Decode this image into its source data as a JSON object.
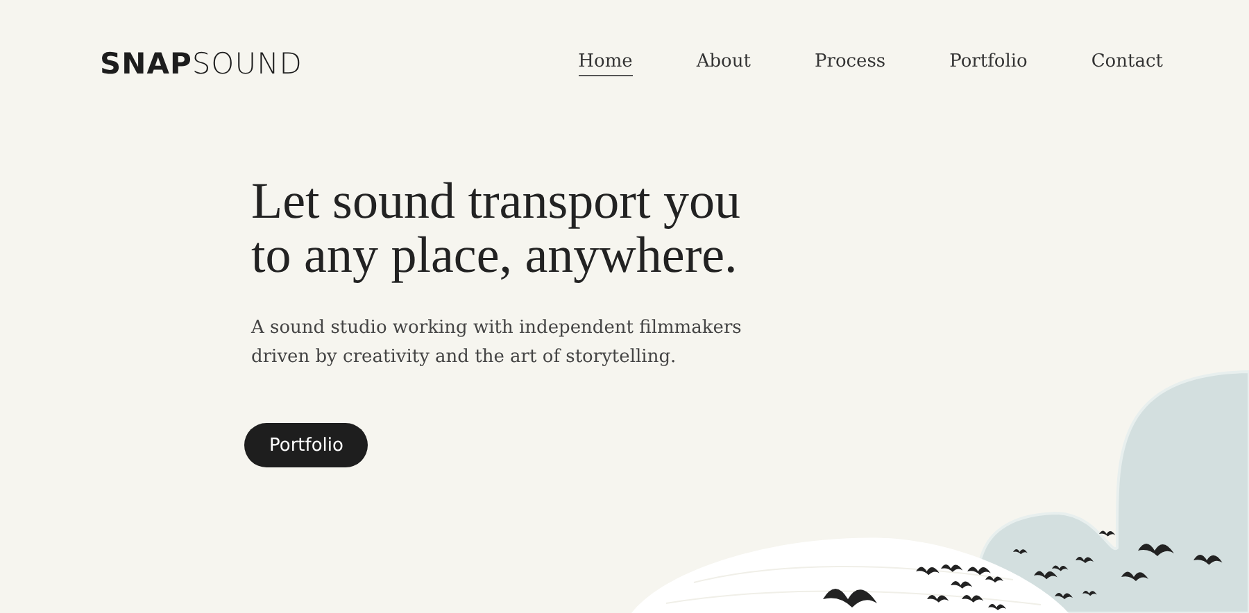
{
  "header": {
    "logo": "**SNAP**SOUND",
    "nav": [
      {
        "label": "Home",
        "selected": true
      },
      {
        "label": "About",
        "selected": false
      },
      {
        "label": "Process",
        "selected": false
      },
      {
        "label": "Portfolio",
        "selected": false
      },
      {
        "label": "Contact",
        "selected": false
      }
    ]
  },
  "hero": {
    "title_lines": [
      "Let sound transport you",
      "to any place, anywhere."
    ],
    "subtitle_lines": [
      "A sound studio working with independent filmmakers",
      "driven by creativity and the art of storytelling."
    ],
    "button": "Portfolio"
  }
}
